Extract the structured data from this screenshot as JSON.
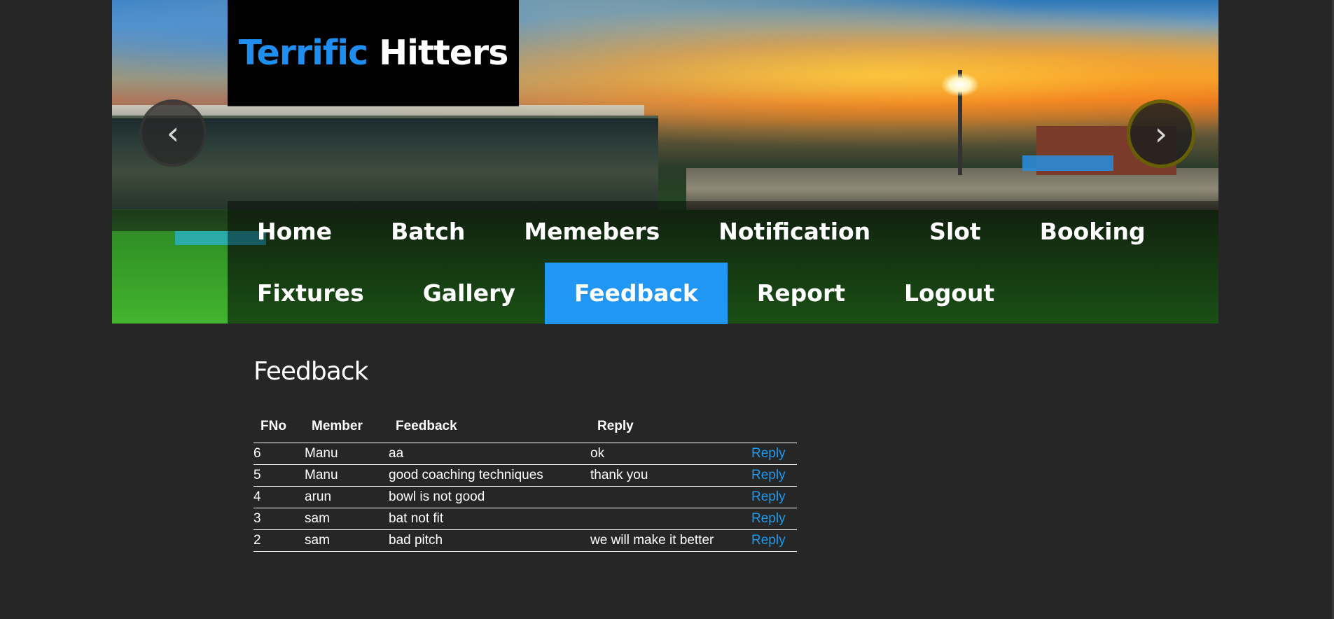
{
  "brand": {
    "part1": "Terrific",
    "part2": "Hitters"
  },
  "slider": {
    "prev_icon": "chevron-left-icon",
    "next_icon": "chevron-right-icon",
    "prev_glyph": "‹",
    "next_glyph": "›"
  },
  "nav": {
    "row1": [
      "Home",
      "Batch",
      "Memebers",
      "Notification",
      "Slot",
      "Booking"
    ],
    "row2": [
      "Fixtures",
      "Gallery",
      "Feedback",
      "Report",
      "Logout"
    ],
    "active": "Feedback"
  },
  "page": {
    "title": "Feedback"
  },
  "table": {
    "headers": [
      "FNo",
      "Member",
      "Feedback",
      "Reply"
    ],
    "rows": [
      {
        "fno": "6",
        "member": "Manu",
        "feedback": "aa",
        "reply": "ok",
        "action": "Reply"
      },
      {
        "fno": "5",
        "member": "Manu",
        "feedback": "good coaching techniques",
        "reply": "thank you",
        "action": "Reply"
      },
      {
        "fno": "4",
        "member": "arun",
        "feedback": "bowl is not good",
        "reply": "",
        "action": "Reply"
      },
      {
        "fno": "3",
        "member": "sam",
        "feedback": "bat not fit",
        "reply": "",
        "action": "Reply"
      },
      {
        "fno": "2",
        "member": "sam",
        "feedback": "bad pitch",
        "reply": "we will make it better",
        "action": "Reply"
      }
    ]
  },
  "colors": {
    "accent": "#2196f3",
    "logo_blue": "#1e8ff0",
    "link": "#1e9bf0",
    "background": "#262626"
  }
}
